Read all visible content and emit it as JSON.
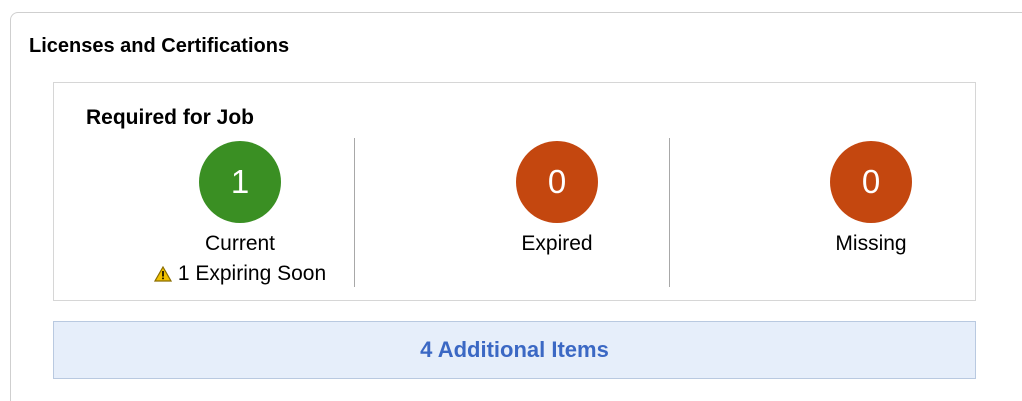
{
  "panel": {
    "title": "Licenses and Certifications"
  },
  "summary": {
    "heading": "Required for Job",
    "current": {
      "count": "1",
      "label": "Current",
      "color": "#3a8f23",
      "warning_icon": "warning-triangle-icon",
      "warning_text": "1 Expiring Soon",
      "warning_color": "#f2c200"
    },
    "expired": {
      "count": "0",
      "label": "Expired",
      "color": "#c4470f"
    },
    "missing": {
      "count": "0",
      "label": "Missing",
      "color": "#c4470f"
    }
  },
  "additional": {
    "label": "4 Additional Items",
    "text_color": "#3b68c4",
    "background": "#e6eefa"
  }
}
